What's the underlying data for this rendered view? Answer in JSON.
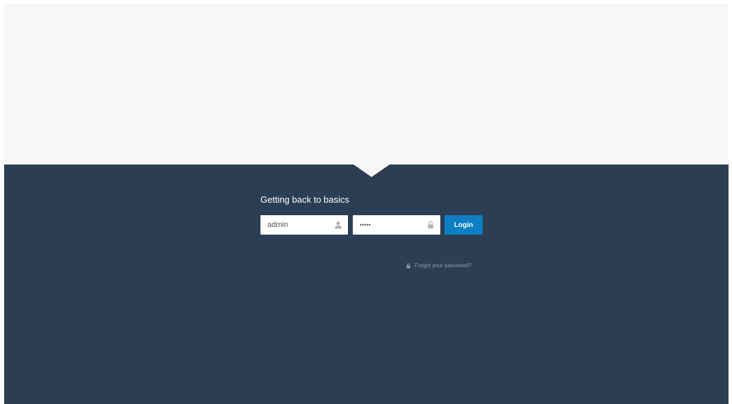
{
  "login": {
    "title": "Getting back to basics",
    "username": {
      "value": "admin",
      "icon": "user-icon"
    },
    "password": {
      "value": "•••••",
      "icon": "lock-icon"
    },
    "button_label": "Login",
    "forgot": {
      "label": "Forgot your password?",
      "icon": "lock-icon"
    }
  },
  "colors": {
    "top_panel": "#f7f7f7",
    "bottom_panel": "#2c3e54",
    "button": "#0d7fc3",
    "link": "#8f9cab"
  }
}
